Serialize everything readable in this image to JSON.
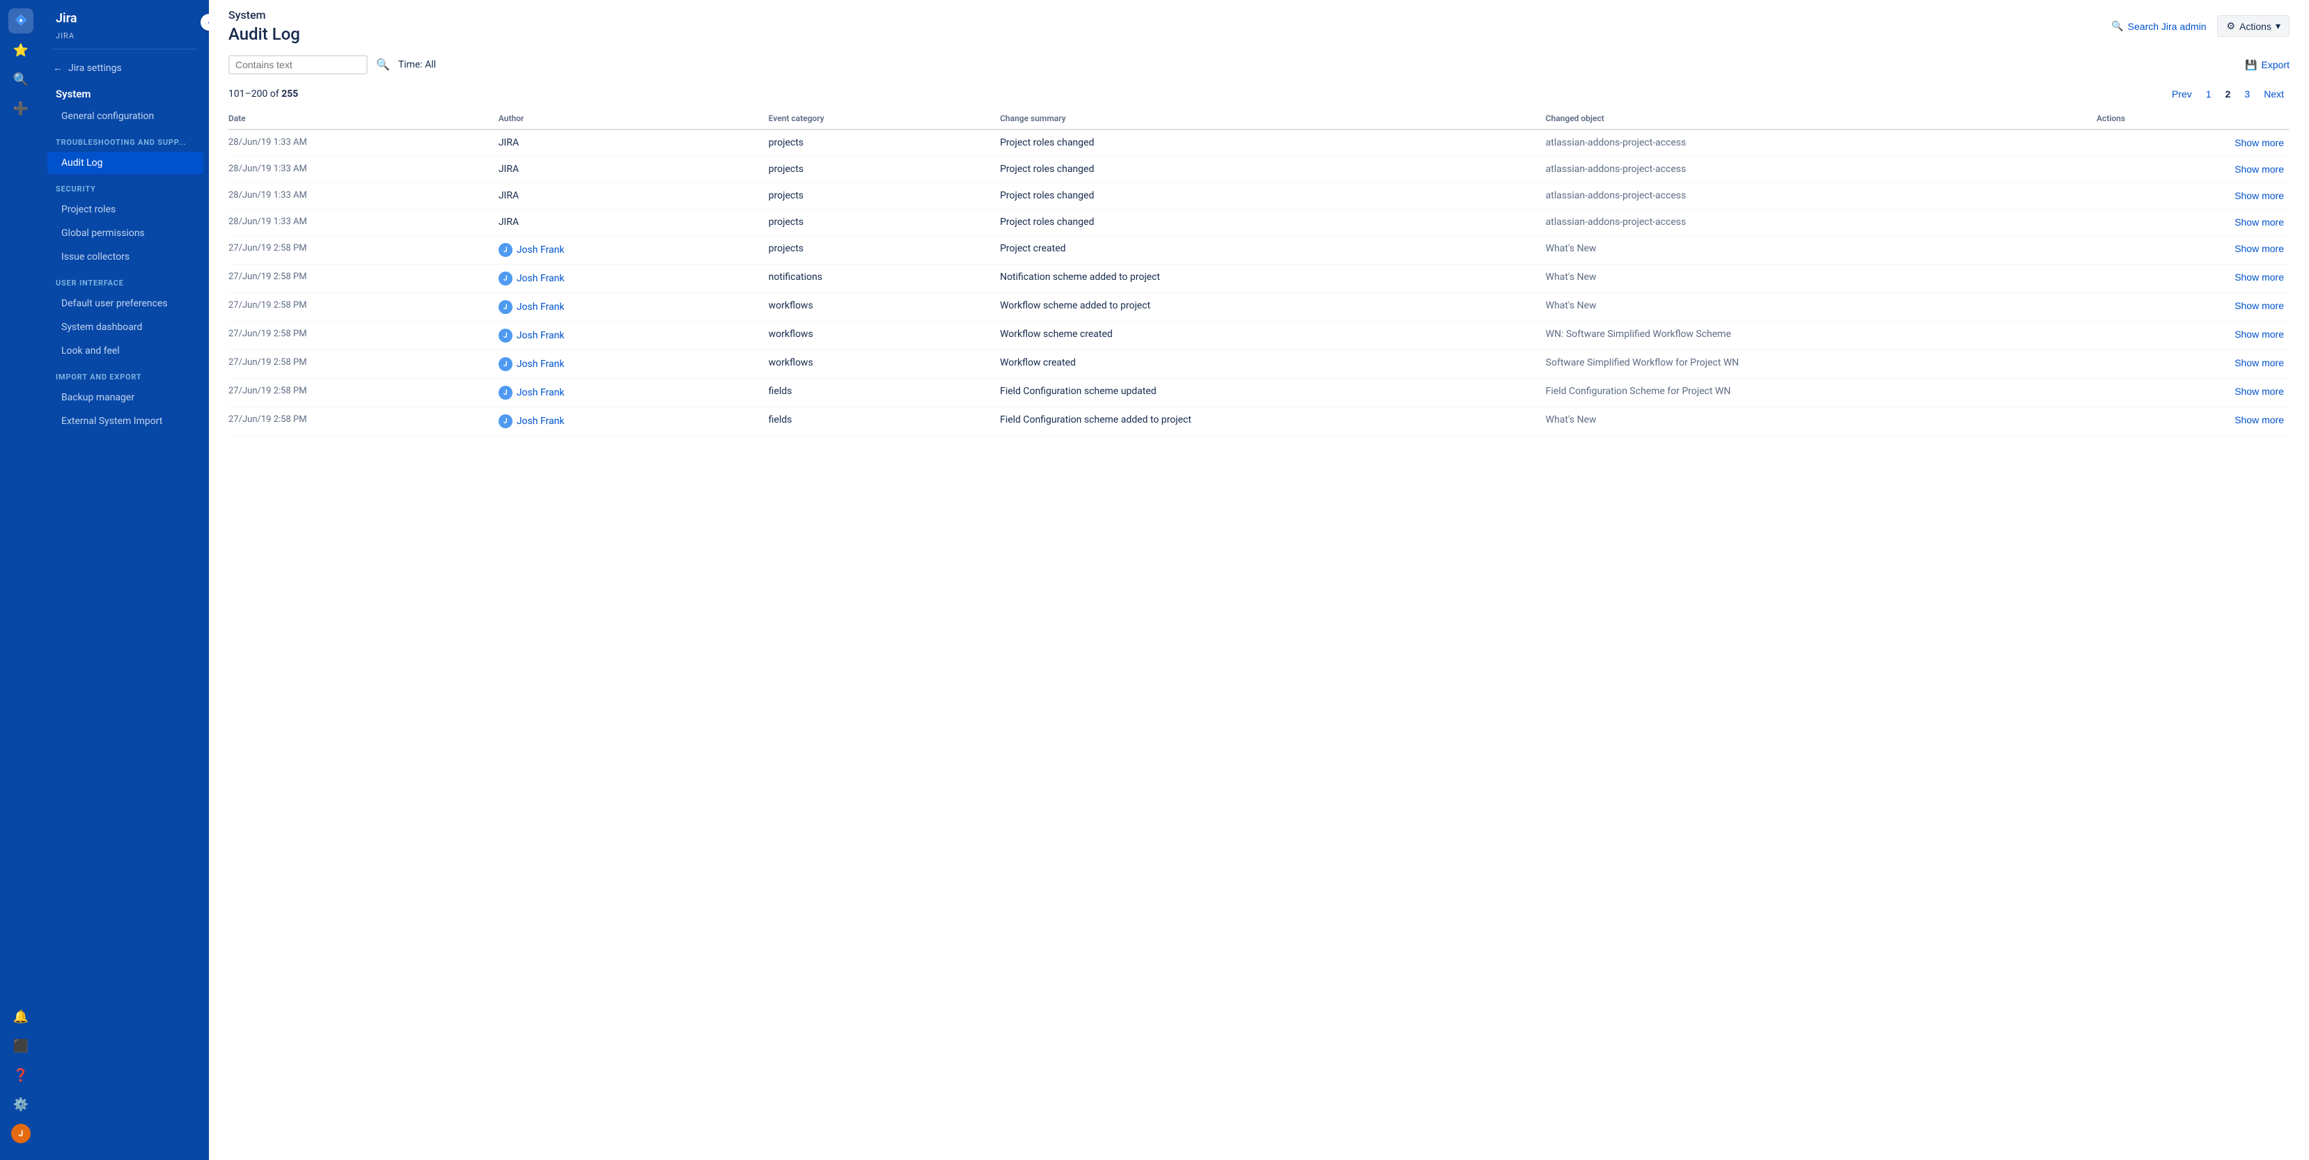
{
  "app": {
    "name": "Jira",
    "subtitle": "JIRA"
  },
  "sidebar": {
    "back_label": "Jira settings",
    "system_label": "System",
    "sections": [
      {
        "title": "",
        "items": [
          {
            "id": "general-configuration",
            "label": "General configuration",
            "active": false
          }
        ]
      },
      {
        "title": "TROUBLESHOOTING AND SUPP...",
        "items": [
          {
            "id": "audit-log",
            "label": "Audit Log",
            "active": true
          }
        ]
      },
      {
        "title": "SECURITY",
        "items": [
          {
            "id": "project-roles",
            "label": "Project roles",
            "active": false
          },
          {
            "id": "global-permissions",
            "label": "Global permissions",
            "active": false
          },
          {
            "id": "issue-collectors",
            "label": "Issue collectors",
            "active": false
          }
        ]
      },
      {
        "title": "USER INTERFACE",
        "items": [
          {
            "id": "default-user-preferences",
            "label": "Default user preferences",
            "active": false
          },
          {
            "id": "system-dashboard",
            "label": "System dashboard",
            "active": false
          },
          {
            "id": "look-and-feel",
            "label": "Look and feel",
            "active": false
          }
        ]
      },
      {
        "title": "IMPORT AND EXPORT",
        "items": [
          {
            "id": "backup-manager",
            "label": "Backup manager",
            "active": false
          },
          {
            "id": "external-system-import",
            "label": "External System Import",
            "active": false
          }
        ]
      }
    ]
  },
  "header": {
    "section": "System",
    "title": "Audit Log",
    "search_admin_label": "Search Jira admin",
    "actions_label": "Actions",
    "export_label": "Export"
  },
  "filter": {
    "search_placeholder": "Contains text",
    "time_label": "Time: All"
  },
  "pagination": {
    "range_start": "101",
    "range_end": "200",
    "total": "255",
    "prev_label": "Prev",
    "next_label": "Next",
    "pages": [
      "1",
      "2",
      "3"
    ],
    "current_page": "2"
  },
  "table": {
    "columns": [
      "Date",
      "Author",
      "Event category",
      "Change summary",
      "Changed object",
      "Actions"
    ],
    "rows": [
      {
        "date": "28/Jun/19 1:33 AM",
        "author": "JIRA",
        "author_type": "system",
        "category": "projects",
        "summary": "Project roles changed",
        "object": "atlassian-addons-project-access",
        "action": "Show more"
      },
      {
        "date": "28/Jun/19 1:33 AM",
        "author": "JIRA",
        "author_type": "system",
        "category": "projects",
        "summary": "Project roles changed",
        "object": "atlassian-addons-project-access",
        "action": "Show more"
      },
      {
        "date": "28/Jun/19 1:33 AM",
        "author": "JIRA",
        "author_type": "system",
        "category": "projects",
        "summary": "Project roles changed",
        "object": "atlassian-addons-project-access",
        "action": "Show more"
      },
      {
        "date": "28/Jun/19 1:33 AM",
        "author": "JIRA",
        "author_type": "system",
        "category": "projects",
        "summary": "Project roles changed",
        "object": "atlassian-addons-project-access",
        "action": "Show more"
      },
      {
        "date": "27/Jun/19 2:58 PM",
        "author": "Josh Frank",
        "author_type": "user",
        "category": "projects",
        "summary": "Project created",
        "object": "What's New",
        "action": "Show more"
      },
      {
        "date": "27/Jun/19 2:58 PM",
        "author": "Josh Frank",
        "author_type": "user",
        "category": "notifications",
        "summary": "Notification scheme added to project",
        "object": "What's New",
        "action": "Show more"
      },
      {
        "date": "27/Jun/19 2:58 PM",
        "author": "Josh Frank",
        "author_type": "user",
        "category": "workflows",
        "summary": "Workflow scheme added to project",
        "object": "What's New",
        "action": "Show more"
      },
      {
        "date": "27/Jun/19 2:58 PM",
        "author": "Josh Frank",
        "author_type": "user",
        "category": "workflows",
        "summary": "Workflow scheme created",
        "object": "WN: Software Simplified Workflow Scheme",
        "action": "Show more"
      },
      {
        "date": "27/Jun/19 2:58 PM",
        "author": "Josh Frank",
        "author_type": "user",
        "category": "workflows",
        "summary": "Workflow created",
        "object": "Software Simplified Workflow for Project WN",
        "action": "Show more"
      },
      {
        "date": "27/Jun/19 2:58 PM",
        "author": "Josh Frank",
        "author_type": "user",
        "category": "fields",
        "summary": "Field Configuration scheme updated",
        "object": "Field Configuration Scheme for Project WN",
        "action": "Show more"
      },
      {
        "date": "27/Jun/19 2:58 PM",
        "author": "Josh Frank",
        "author_type": "user",
        "category": "fields",
        "summary": "Field Configuration scheme added to project",
        "object": "What's New",
        "action": "Show more"
      }
    ]
  }
}
